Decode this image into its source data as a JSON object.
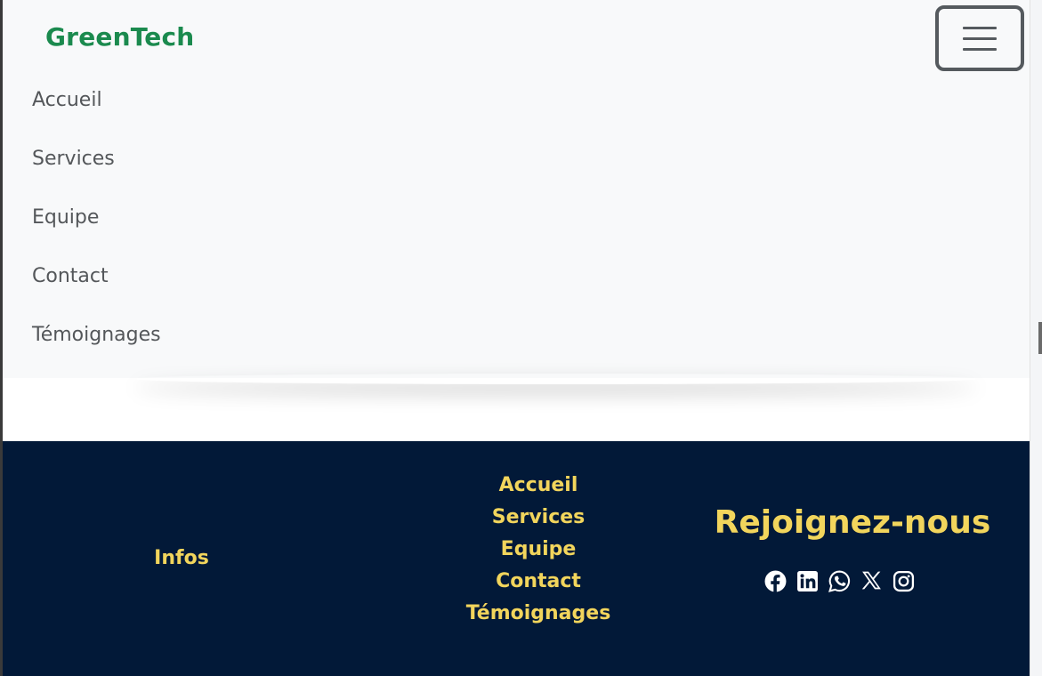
{
  "navbar": {
    "brand": "GreenTech",
    "toggler_icon": "hamburger-icon",
    "items": [
      {
        "label": "Accueil"
      },
      {
        "label": "Services"
      },
      {
        "label": "Equipe"
      },
      {
        "label": "Contact"
      },
      {
        "label": "Témoignages"
      }
    ]
  },
  "footer": {
    "infos_label": "Infos",
    "links": [
      {
        "label": "Accueil"
      },
      {
        "label": "Services"
      },
      {
        "label": "Equipe"
      },
      {
        "label": "Contact"
      },
      {
        "label": "Témoignages"
      }
    ],
    "join_title": "Rejoignez-nous",
    "social_icons": [
      "facebook-icon",
      "linkedin-icon",
      "whatsapp-icon",
      "x-icon",
      "instagram-icon"
    ]
  },
  "colors": {
    "brand": "#1b8a4e",
    "footer_bg": "#021938",
    "footer_accent": "#f2d55c",
    "navbar_bg": "#f8f9fa"
  }
}
